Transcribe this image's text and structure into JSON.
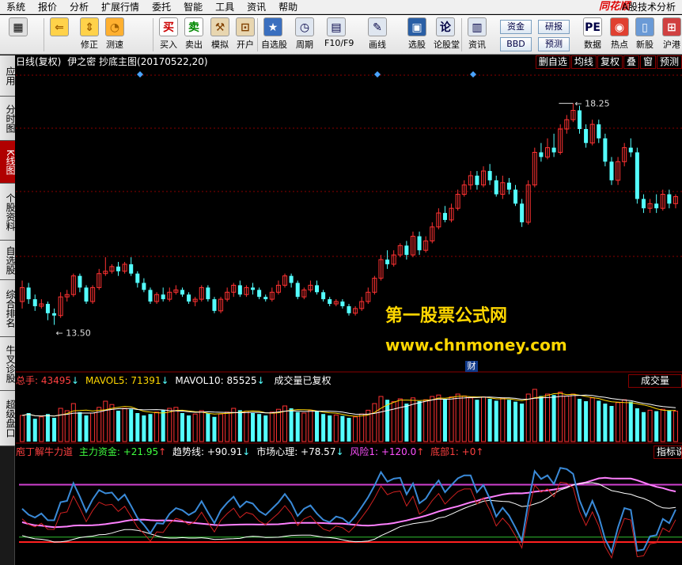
{
  "menu": [
    "系统",
    "报价",
    "分析",
    "扩展行情",
    "委托",
    "智能",
    "工具",
    "资讯",
    "帮助"
  ],
  "brand": "同花顺",
  "app_title": "A股技术分析",
  "toolbar": [
    {
      "label": "",
      "icon": "layout-icon"
    },
    {
      "label": "",
      "icon": "back-arrow-icon"
    },
    {
      "label": "修正",
      "icon": "up-down-arrow-icon"
    },
    {
      "label": "测速",
      "icon": "speed-icon"
    },
    {
      "label": "买入",
      "icon": "buy-icon",
      "glyph": "买"
    },
    {
      "label": "卖出",
      "icon": "sell-icon",
      "glyph": "卖"
    },
    {
      "label": "模拟",
      "icon": "hammer-icon"
    },
    {
      "label": "开户",
      "icon": "lock-icon"
    },
    {
      "label": "自选股",
      "icon": "star-icon"
    },
    {
      "label": "周期",
      "icon": "clock-icon"
    },
    {
      "label": "F10/F9",
      "icon": "f10-icon"
    },
    {
      "label": "画线",
      "icon": "pencil-icon"
    },
    {
      "label": "选股",
      "icon": "screen-icon"
    },
    {
      "label": "论股堂",
      "icon": "forum-icon"
    },
    {
      "label": "资讯",
      "icon": "news-icon"
    },
    {
      "label": "数据",
      "icon": "pe-icon",
      "glyph": "PE"
    },
    {
      "label": "热点",
      "icon": "hot-icon"
    },
    {
      "label": "新股",
      "icon": "ipo-icon"
    },
    {
      "label": "沪港",
      "icon": "hk-icon"
    }
  ],
  "toolbar_buttons": [
    "资金",
    "研报",
    "BBD",
    "预测"
  ],
  "sidebar": [
    {
      "label": "应用",
      "active": false
    },
    {
      "label": "分时图",
      "active": false
    },
    {
      "label": "K线图",
      "active": true
    },
    {
      "label": "个股资料",
      "active": false
    },
    {
      "label": "自选股",
      "active": false
    },
    {
      "label": "综合排名",
      "active": false
    },
    {
      "label": "牛叉诊股",
      "active": false
    },
    {
      "label": "超级盘口",
      "active": false
    }
  ],
  "kline_header": {
    "title": "日线(复权)",
    "indicator": "伊之密 抄底主图(20170522,20)",
    "buttons": [
      "删自选",
      "均线",
      "复权",
      "叠",
      "窗",
      "预测"
    ]
  },
  "high_label": "18.25",
  "low_label": "13.50",
  "watermark": {
    "line1": "第一股票公式网",
    "line2": "www.chnmoney.com"
  },
  "cai_badge": "财",
  "volume_header": {
    "total": "总手: 43495",
    "mavol5": "MAVOL5: 71391",
    "mavol10": "MAVOL10: 85525",
    "note": "成交量已复权",
    "right_label": "成交量"
  },
  "indicator_header": {
    "name": "庖丁解牛力道",
    "main_fund": "主力资金: +21.95",
    "trend": "趋势线: +90.91",
    "market": "市场心理: +78.57",
    "risk": "风险1: +120.0",
    "bottom": "底部1: +0",
    "right_label": "指标说"
  },
  "colors": {
    "up": "#ff3232",
    "down": "#54ffff",
    "bg": "#000000",
    "grid": "#8a0000",
    "yellow": "#ffd700"
  },
  "chart_data": {
    "type": "candlestick",
    "price_range": [
      13.0,
      18.6
    ],
    "candles": [
      [
        14.0,
        14.3,
        14.45,
        13.85
      ],
      [
        14.3,
        14.05,
        14.4,
        13.95
      ],
      [
        14.05,
        13.9,
        14.15,
        13.8
      ],
      [
        13.9,
        13.95,
        14.05,
        13.85
      ],
      [
        13.95,
        13.75,
        14.0,
        13.6
      ],
      [
        13.75,
        13.7,
        13.85,
        13.5
      ],
      [
        13.7,
        14.1,
        14.2,
        13.65
      ],
      [
        14.1,
        14.15,
        14.25,
        14.0
      ],
      [
        14.15,
        14.55,
        14.6,
        14.1
      ],
      [
        14.55,
        14.3,
        14.6,
        14.2
      ],
      [
        14.3,
        14.0,
        14.35,
        13.95
      ],
      [
        14.0,
        14.3,
        14.35,
        13.95
      ],
      [
        14.3,
        14.6,
        14.7,
        14.25
      ],
      [
        14.6,
        14.65,
        14.95,
        14.55
      ],
      [
        14.65,
        14.75,
        14.8,
        14.6
      ],
      [
        14.75,
        14.65,
        14.85,
        14.55
      ],
      [
        14.65,
        14.8,
        14.85,
        14.6
      ],
      [
        14.8,
        14.6,
        14.95,
        14.55
      ],
      [
        14.6,
        14.4,
        14.65,
        14.3
      ],
      [
        14.4,
        14.25,
        14.5,
        14.2
      ],
      [
        14.25,
        14.0,
        14.3,
        13.95
      ],
      [
        14.0,
        14.15,
        14.2,
        13.95
      ],
      [
        14.15,
        14.05,
        14.3,
        14.0
      ],
      [
        14.05,
        14.2,
        14.3,
        14.0
      ],
      [
        14.2,
        14.25,
        14.35,
        14.15
      ],
      [
        14.25,
        14.15,
        14.3,
        14.1
      ],
      [
        14.15,
        14.0,
        14.2,
        13.95
      ],
      [
        14.0,
        14.05,
        14.1,
        13.9
      ],
      [
        14.05,
        14.3,
        14.35,
        14.0
      ],
      [
        14.3,
        14.05,
        14.35,
        14.0
      ],
      [
        14.05,
        13.8,
        14.1,
        13.75
      ],
      [
        13.8,
        14.05,
        14.1,
        13.75
      ],
      [
        14.05,
        14.2,
        14.3,
        14.0
      ],
      [
        14.2,
        14.35,
        14.4,
        14.1
      ],
      [
        14.35,
        14.15,
        14.45,
        14.1
      ],
      [
        14.15,
        14.3,
        14.35,
        14.1
      ],
      [
        14.3,
        14.25,
        14.4,
        14.15
      ],
      [
        14.25,
        14.1,
        14.3,
        14.05
      ],
      [
        14.1,
        14.05,
        14.15,
        14.0
      ],
      [
        14.05,
        14.2,
        14.3,
        14.0
      ],
      [
        14.2,
        14.35,
        14.45,
        14.15
      ],
      [
        14.35,
        14.55,
        14.6,
        14.3
      ],
      [
        14.55,
        14.4,
        14.6,
        14.3
      ],
      [
        14.4,
        14.1,
        14.45,
        14.05
      ],
      [
        14.1,
        14.25,
        14.3,
        14.05
      ],
      [
        14.25,
        14.35,
        14.45,
        14.2
      ],
      [
        14.35,
        14.2,
        14.45,
        14.15
      ],
      [
        14.2,
        14.05,
        14.25,
        14.0
      ],
      [
        14.05,
        13.95,
        14.1,
        13.9
      ],
      [
        13.95,
        14.0,
        14.05,
        13.9
      ],
      [
        14.0,
        13.9,
        14.05,
        13.85
      ],
      [
        13.9,
        13.75,
        13.95,
        13.7
      ],
      [
        13.75,
        13.85,
        13.9,
        13.7
      ],
      [
        13.85,
        14.0,
        14.1,
        13.8
      ],
      [
        14.0,
        14.2,
        14.3,
        13.95
      ],
      [
        14.2,
        14.5,
        14.55,
        14.15
      ],
      [
        14.5,
        14.9,
        15.0,
        14.45
      ],
      [
        14.9,
        14.8,
        15.1,
        14.7
      ],
      [
        14.8,
        15.0,
        15.1,
        14.75
      ],
      [
        15.0,
        15.2,
        15.25,
        14.95
      ],
      [
        15.2,
        15.0,
        15.3,
        14.9
      ],
      [
        15.0,
        15.4,
        15.5,
        14.95
      ],
      [
        15.4,
        15.1,
        15.5,
        15.0
      ],
      [
        15.1,
        15.3,
        15.4,
        15.05
      ],
      [
        15.3,
        15.6,
        15.7,
        15.25
      ],
      [
        15.6,
        15.9,
        16.0,
        15.55
      ],
      [
        15.9,
        15.75,
        16.05,
        15.7
      ],
      [
        15.75,
        16.0,
        16.1,
        15.7
      ],
      [
        16.0,
        16.3,
        16.4,
        15.95
      ],
      [
        16.3,
        16.5,
        16.6,
        16.25
      ],
      [
        16.5,
        16.7,
        16.8,
        16.4
      ],
      [
        16.7,
        16.5,
        16.8,
        16.4
      ],
      [
        16.5,
        16.8,
        16.9,
        16.45
      ],
      [
        16.8,
        16.6,
        16.95,
        16.5
      ],
      [
        16.6,
        16.3,
        16.7,
        16.25
      ],
      [
        16.3,
        16.55,
        16.7,
        16.2
      ],
      [
        16.55,
        16.4,
        16.65,
        16.3
      ],
      [
        16.4,
        16.1,
        16.5,
        16.05
      ],
      [
        16.1,
        15.7,
        16.2,
        15.6
      ],
      [
        15.7,
        16.5,
        16.6,
        15.65
      ],
      [
        16.5,
        17.2,
        17.3,
        16.45
      ],
      [
        17.2,
        17.1,
        17.4,
        17.0
      ],
      [
        17.1,
        17.3,
        17.5,
        17.05
      ],
      [
        17.3,
        17.2,
        17.6,
        17.1
      ],
      [
        17.2,
        17.7,
        17.8,
        17.15
      ],
      [
        17.7,
        17.9,
        18.0,
        17.6
      ],
      [
        17.9,
        18.1,
        18.25,
        17.85
      ],
      [
        18.1,
        17.7,
        18.2,
        17.6
      ],
      [
        17.7,
        17.4,
        17.8,
        17.3
      ],
      [
        17.4,
        17.8,
        17.9,
        17.35
      ],
      [
        17.8,
        17.5,
        17.9,
        17.4
      ],
      [
        17.5,
        17.0,
        17.6,
        16.9
      ],
      [
        17.0,
        16.6,
        17.1,
        16.5
      ],
      [
        16.6,
        17.0,
        17.1,
        16.5
      ],
      [
        17.0,
        17.3,
        17.4,
        16.9
      ],
      [
        17.3,
        17.2,
        17.5,
        17.1
      ],
      [
        17.2,
        16.2,
        17.3,
        16.1
      ],
      [
        16.2,
        16.0,
        16.3,
        15.9
      ],
      [
        16.0,
        16.1,
        16.2,
        15.9
      ],
      [
        16.1,
        16.0,
        16.3,
        15.9
      ],
      [
        16.0,
        16.3,
        16.4,
        15.95
      ],
      [
        16.3,
        16.1,
        16.4,
        16.0
      ],
      [
        16.1,
        16.25,
        16.3,
        16.0
      ]
    ],
    "volume": [
      55,
      60,
      48,
      52,
      58,
      50,
      70,
      65,
      80,
      62,
      55,
      60,
      72,
      85,
      78,
      65,
      70,
      68,
      60,
      55,
      58,
      62,
      66,
      70,
      72,
      60,
      55,
      58,
      65,
      60,
      52,
      58,
      62,
      70,
      66,
      64,
      60,
      58,
      55,
      62,
      68,
      75,
      70,
      62,
      60,
      66,
      64,
      58,
      55,
      56,
      54,
      50,
      52,
      58,
      66,
      80,
      95,
      88,
      84,
      90,
      80,
      92,
      85,
      88,
      95,
      98,
      90,
      94,
      100,
      96,
      92,
      88,
      94,
      90,
      86,
      92,
      88,
      84,
      80,
      100,
      110,
      96,
      100,
      98,
      104,
      96,
      100,
      90,
      85,
      92,
      86,
      80,
      75,
      82,
      88,
      84,
      70,
      62,
      66,
      64,
      68,
      66,
      64
    ]
  }
}
